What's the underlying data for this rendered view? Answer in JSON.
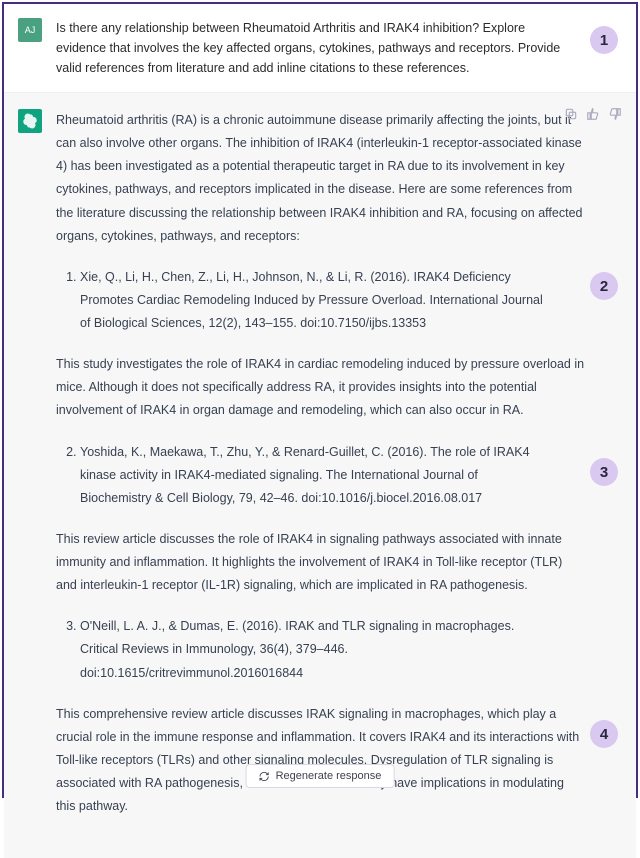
{
  "user": {
    "avatar_text": "AJ",
    "prompt": "Is there any relationship between Rheumatoid Arthritis and IRAK4 inhibition? Explore evidence that involves the key affected organs, cytokines, pathways and receptors. Provide valid references from literature and add inline citations to these references."
  },
  "assistant": {
    "intro": "Rheumatoid arthritis (RA) is a chronic autoimmune disease primarily affecting the joints, but it can also involve other organs. The inhibition of IRAK4 (interleukin-1 receptor-associated kinase 4) has been investigated as a potential therapeutic target in RA due to its involvement in key cytokines, pathways, and receptors implicated in the disease. Here are some references from the literature discussing the relationship between IRAK4 inhibition and RA, focusing on affected organs, cytokines, pathways, and receptors:",
    "refs": [
      {
        "citation": "Xie, Q., Li, H., Chen, Z., Li, H., Johnson, N., & Li, R. (2016). IRAK4 Deficiency Promotes Cardiac Remodeling Induced by Pressure Overload. International Journal of Biological Sciences, 12(2), 143–155. doi:10.7150/ijbs.13353",
        "note": "This study investigates the role of IRAK4 in cardiac remodeling induced by pressure overload in mice. Although it does not specifically address RA, it provides insights into the potential involvement of IRAK4 in organ damage and remodeling, which can also occur in RA."
      },
      {
        "citation": "Yoshida, K., Maekawa, T., Zhu, Y., & Renard-Guillet, C. (2016). The role of IRAK4 kinase activity in IRAK4-mediated signaling. The International Journal of Biochemistry & Cell Biology, 79, 42–46. doi:10.1016/j.biocel.2016.08.017",
        "note": "This review article discusses the role of IRAK4 in signaling pathways associated with innate immunity and inflammation. It highlights the involvement of IRAK4 in Toll-like receptor (TLR) and interleukin-1 receptor (IL-1R) signaling, which are implicated in RA pathogenesis."
      },
      {
        "citation": "O'Neill, L. A. J., & Dumas, E. (2016). IRAK and TLR signaling in macrophages. Critical Reviews in Immunology, 36(4), 379–446. doi:10.1615/critrevimmunol.2016016844",
        "note": "This comprehensive review article discusses IRAK signaling in macrophages, which play a crucial role in the immune response and inflammation. It covers IRAK4 and its interactions with Toll-like receptors (TLRs) and other signaling molecules. Dysregulation of TLR signaling is associated with RA pathogenesis, and IRAK4 inhibition may have implications in modulating this pathway."
      }
    ]
  },
  "regen_label": "Regenerate response",
  "callouts": {
    "c1": "1",
    "c2": "2",
    "c3": "3",
    "c4": "4"
  }
}
